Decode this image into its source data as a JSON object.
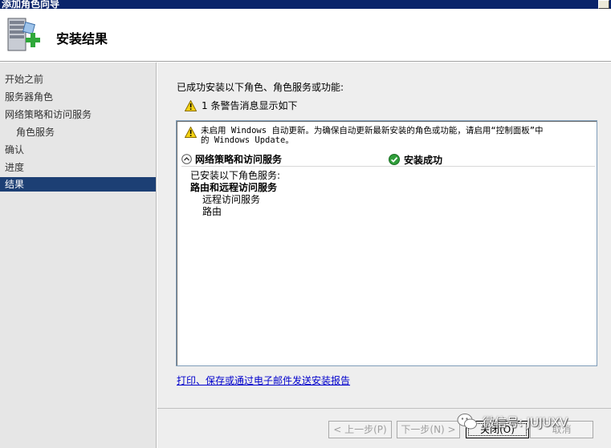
{
  "window": {
    "title": "添加角色向导"
  },
  "header": {
    "title": "安装结果"
  },
  "sidebar": {
    "items": [
      {
        "label": "开始之前"
      },
      {
        "label": "服务器角色"
      },
      {
        "label": "网络策略和访问服务"
      },
      {
        "label": "角色服务"
      },
      {
        "label": "确认"
      },
      {
        "label": "进度"
      },
      {
        "label": "结果"
      }
    ]
  },
  "main": {
    "success_message": "已成功安装以下角色、角色服务或功能:",
    "warning_count_message": "1 条警告消息显示如下",
    "result": {
      "notice_line1": "未启用 Windows 自动更新。为确保自动更新最新安装的角色或功能，请启用“控制面板”中",
      "notice_line2": "的 Windows Update。",
      "role_name": "网络策略和访问服务",
      "status": "安装成功",
      "installed_label": "已安装以下角色服务:",
      "group_name": "路由和远程访问服务",
      "service1": "远程访问服务",
      "service2": "路由"
    },
    "report_link": "打印、保存或通过电子邮件发送安装报告"
  },
  "buttons": {
    "back": "< 上一步(P)",
    "next": "下一步(N) >",
    "close": "关闭(O)",
    "cancel": "取消"
  },
  "watermark": {
    "text": "微信号: JUJUXV"
  },
  "colors": {
    "titlebar": "#0a246a",
    "sidebar_active": "#1c3f74",
    "link": "#0000cc"
  }
}
